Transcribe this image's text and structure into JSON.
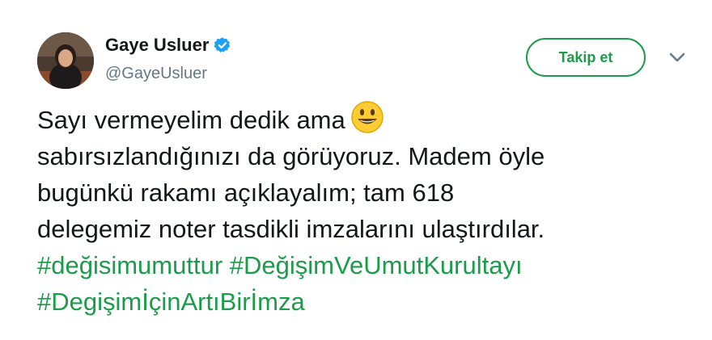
{
  "user": {
    "name": "Gaye Usluer",
    "handle": "@GayeUsluer",
    "verified": true
  },
  "follow_button": {
    "label": "Takip et"
  },
  "menu": {
    "icon": "chevron-down-icon"
  },
  "tweet": {
    "lines": [
      "Sayı vermeyelim dedik ama",
      "sabırsızlandığınızı da görüyoruz. Madem öyle",
      "bugünkü rakamı açıklayalım; tam 618",
      "delegemiz noter tasdikli imzalarını ulaştırdılar."
    ],
    "emoji": "smiling-face-emoji",
    "hashtags": [
      "#değisimumuttur",
      "#DeğişimVeUmutKurultayı",
      "#DegişimİçinArtıBirİmza"
    ]
  },
  "colors": {
    "accent": "#1c9c4b",
    "verified": "#1da1f2",
    "handle": "#657786",
    "text": "#14171a"
  }
}
